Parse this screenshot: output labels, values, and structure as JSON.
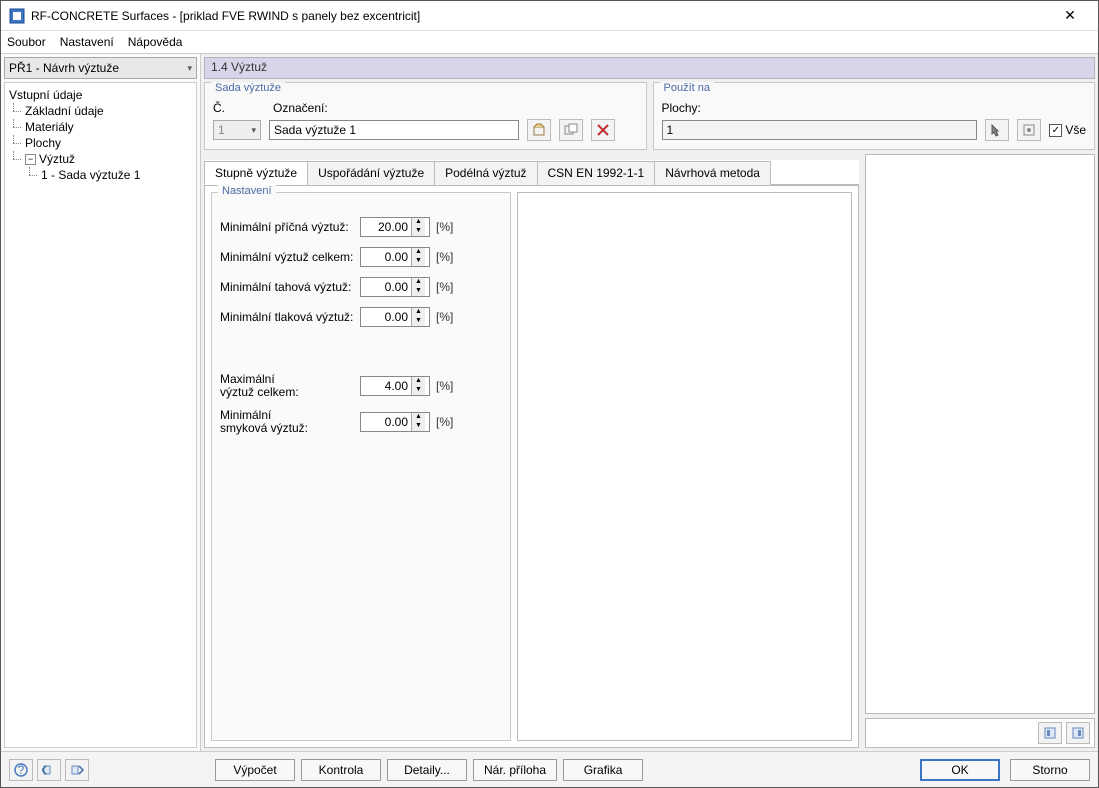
{
  "titlebar": {
    "text": "RF-CONCRETE Surfaces - [priklad FVE RWIND s panely bez excentricit]"
  },
  "menu": {
    "file": "Soubor",
    "settings": "Nastavení",
    "help": "Nápověda"
  },
  "sidebar": {
    "combo": "PŘ1 - Návrh výztuže",
    "root": "Vstupní údaje",
    "items": [
      "Základní údaje",
      "Materiály",
      "Plochy"
    ],
    "group": "Výztuž",
    "subitem": "1 - Sada výztuže 1"
  },
  "header": "1.4 Výztuž",
  "group_left": {
    "title": "Sada výztuže",
    "num_lbl": "Č.",
    "num_val": "1",
    "name_lbl": "Označení:",
    "name_val": "Sada výztuže 1"
  },
  "group_right": {
    "title": "Použít na",
    "lbl": "Plochy:",
    "val": "1",
    "all": "Vše"
  },
  "tabs": [
    "Stupně výztuže",
    "Uspořádání výztuže",
    "Podélná výztuž",
    "CSN EN 1992-1-1",
    "Návrhová metoda"
  ],
  "settings": {
    "title": "Nastavení",
    "rows": [
      {
        "label": "Minimální příčná výztuž:",
        "value": "20.00",
        "unit": "[%]"
      },
      {
        "label": "Minimální výztuž celkem:",
        "value": "0.00",
        "unit": "[%]"
      },
      {
        "label": "Minimální tahová výztuž:",
        "value": "0.00",
        "unit": "[%]"
      },
      {
        "label": "Minimální tlaková výztuž:",
        "value": "0.00",
        "unit": "[%]"
      }
    ],
    "rows2": [
      {
        "label": "Maximální\nvýztuž celkem:",
        "value": "4.00",
        "unit": "[%]"
      },
      {
        "label": "Minimální\nsmyková výztuž:",
        "value": "0.00",
        "unit": "[%]"
      }
    ]
  },
  "footer": {
    "buttons": [
      "Výpočet",
      "Kontrola",
      "Detaily...",
      "Nár. příloha",
      "Grafika"
    ],
    "ok": "OK",
    "cancel": "Storno"
  }
}
